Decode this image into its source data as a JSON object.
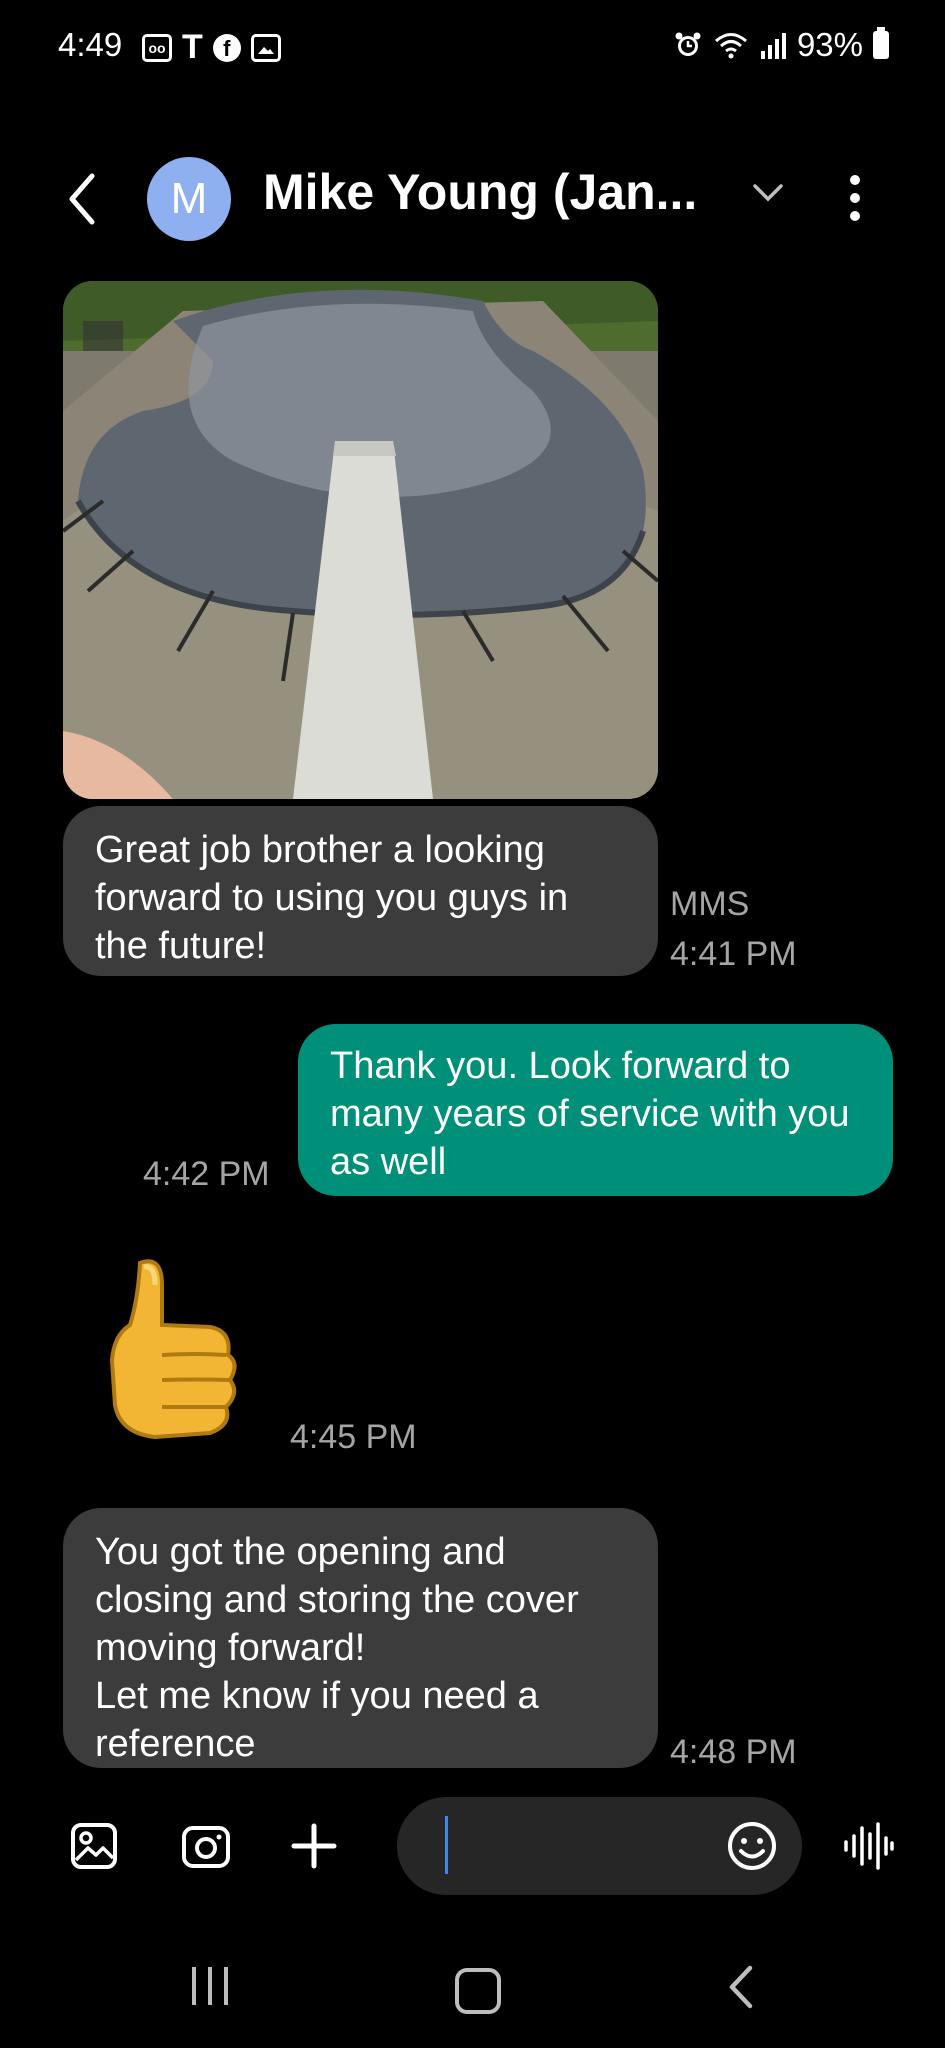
{
  "status_bar": {
    "time": "4:49",
    "battery": "93%",
    "left_icons": [
      "voicemail-icon",
      "tmobile-icon",
      "facebook-icon",
      "gallery-icon"
    ],
    "right_icons": [
      "alarm-icon",
      "wifi-icon",
      "signal-icon",
      "battery-icon"
    ]
  },
  "header": {
    "avatar_letter": "M",
    "contact_name": "Mike Young (Jan...",
    "avatar_color": "#8fb0f0"
  },
  "messages": [
    {
      "direction": "incoming",
      "type": "image",
      "image_desc": "covered pool with diving board"
    },
    {
      "direction": "incoming",
      "type": "text",
      "text": "Great job brother a looking forward to using you guys in the future!",
      "tag": "MMS",
      "time": "4:41 PM"
    },
    {
      "direction": "outgoing",
      "type": "text",
      "text": "Thank you.   Look forward to many years of service with you as well",
      "time": "4:42 PM"
    },
    {
      "direction": "incoming",
      "type": "emoji",
      "emoji": "👍",
      "time": "4:45 PM"
    },
    {
      "direction": "incoming",
      "type": "text",
      "text": "You got the opening and closing and storing the cover moving forward!\nLet me know if you need a reference",
      "time": "4:48 PM"
    }
  ],
  "colors": {
    "incoming_bubble": "#3c3c3c",
    "outgoing_bubble": "#00907a",
    "background": "#000000",
    "caret": "#3a86f2"
  },
  "composer": {
    "value": "",
    "buttons": [
      "gallery-icon",
      "camera-icon",
      "plus-icon",
      "emoji-icon",
      "voice-icon"
    ]
  },
  "nav_bar": [
    "recents-icon",
    "home-icon",
    "back-icon"
  ]
}
